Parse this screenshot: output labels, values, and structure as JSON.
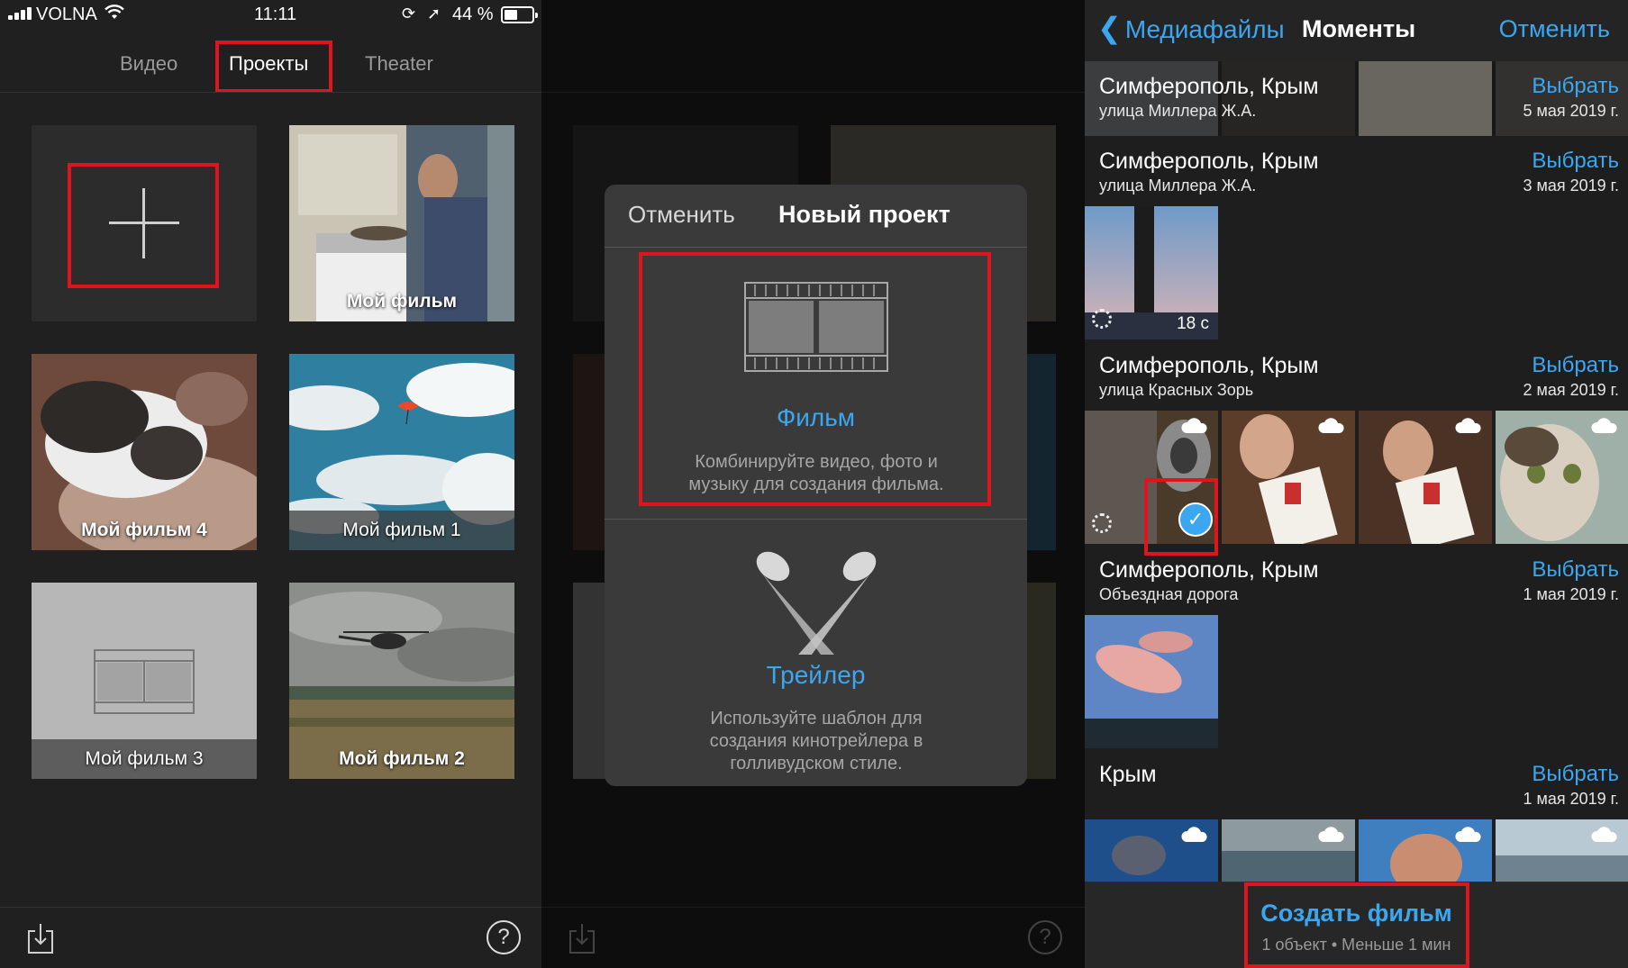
{
  "status_bar": {
    "carrier": "VOLNA",
    "time": "11:11",
    "battery": "44 %",
    "battery_level_percent": 44
  },
  "tabs": {
    "video": "Видео",
    "projects": "Проекты",
    "theater": "Theater",
    "active": "projects"
  },
  "projects": {
    "new_project_icon": "plus-icon",
    "items": [
      {
        "title": "Мой фильм"
      },
      {
        "title": "Мой фильм 4"
      },
      {
        "title": "Мой фильм 1"
      },
      {
        "title": "Мой фильм 3"
      },
      {
        "title": "Мой фильм 2"
      }
    ]
  },
  "bottom_bar": {
    "import_icon": "import-icon",
    "help_label": "?"
  },
  "new_project_dialog": {
    "cancel": "Отменить",
    "title": "Новый проект",
    "movie": {
      "title": "Фильм",
      "description": "Комбинируйте видео, фото и музыку для создания фильма.",
      "icon": "film-strip-icon"
    },
    "trailer": {
      "title": "Трейлер",
      "description": "Используйте шаблон для создания кинотрейлера в голливудском стиле.",
      "icon": "spotlights-icon"
    }
  },
  "media_picker": {
    "back_label": "Медиафайлы",
    "title": "Моменты",
    "cancel": "Отменить",
    "select_label": "Выбрать",
    "moments": [
      {
        "title": "Симферополь, Крым",
        "subtitle": "улица Миллера Ж.А.",
        "date": "5 мая 2019 г."
      },
      {
        "title": "Симферополь, Крым",
        "subtitle": "улица Миллера Ж.А.",
        "date": "3 мая 2019 г.",
        "video_duration": "18 с"
      },
      {
        "title": "Симферополь, Крым",
        "subtitle": "улица Красных Зорь",
        "date": "2 мая 2019 г."
      },
      {
        "title": "Симферополь, Крым",
        "subtitle": "Объездная дорога",
        "date": "1 мая 2019 г."
      },
      {
        "title": "Крым",
        "subtitle": "",
        "date": "1 мая 2019 г."
      }
    ],
    "create_movie": "Создать фильм",
    "create_movie_info": "1 объект • Меньше 1 мин"
  },
  "colors": {
    "accent_blue": "#3aa7f0",
    "highlight_red": "#e0141e",
    "background_dark": "#202020"
  }
}
